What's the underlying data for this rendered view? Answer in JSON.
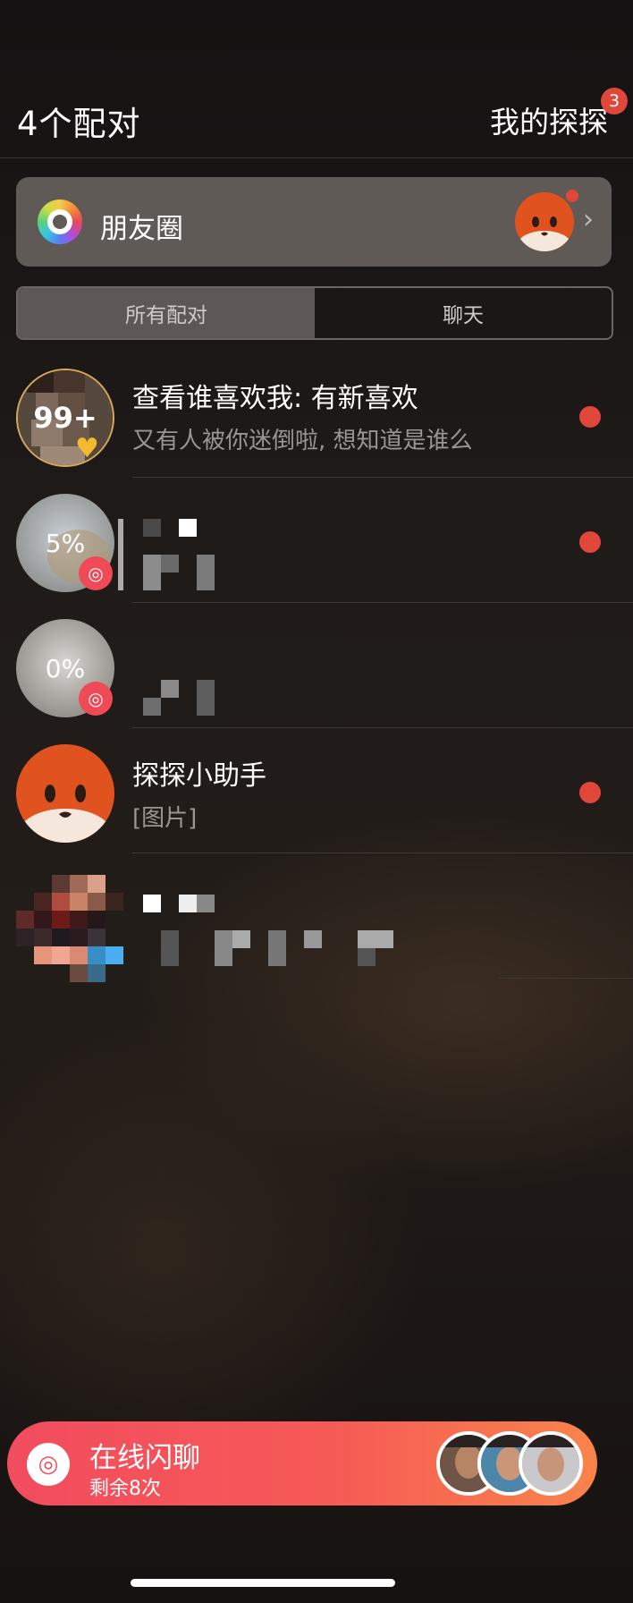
{
  "header": {
    "title": "4个配对",
    "my_tantan": "我的探探",
    "badge_count": "3"
  },
  "moments": {
    "label": "朋友圈",
    "icon": "color-wheel-icon",
    "chevron": "›"
  },
  "tabs": [
    {
      "label": "所有配对",
      "active": true
    },
    {
      "label": "聊天",
      "active": false
    }
  ],
  "rows": [
    {
      "title": "查看谁喜欢我: 有新喜欢",
      "subtitle": "又有人被你迷倒啦, 想知道是谁么",
      "avatar_text": "99+",
      "unread": true
    },
    {
      "avatar_text": "5%",
      "unread": true
    },
    {
      "avatar_text": "0%",
      "unread": false
    },
    {
      "title": "探探小助手",
      "subtitle": "[图片]",
      "unread": true
    },
    {
      "unread": false
    }
  ],
  "banner": {
    "title": "在线闪聊",
    "subtitle": "剩余8次",
    "icon": "flash-chat-icon"
  },
  "colors": {
    "accent_red": "#e0473a",
    "banner_start": "#f24c5f",
    "banner_end": "#f9844a"
  }
}
